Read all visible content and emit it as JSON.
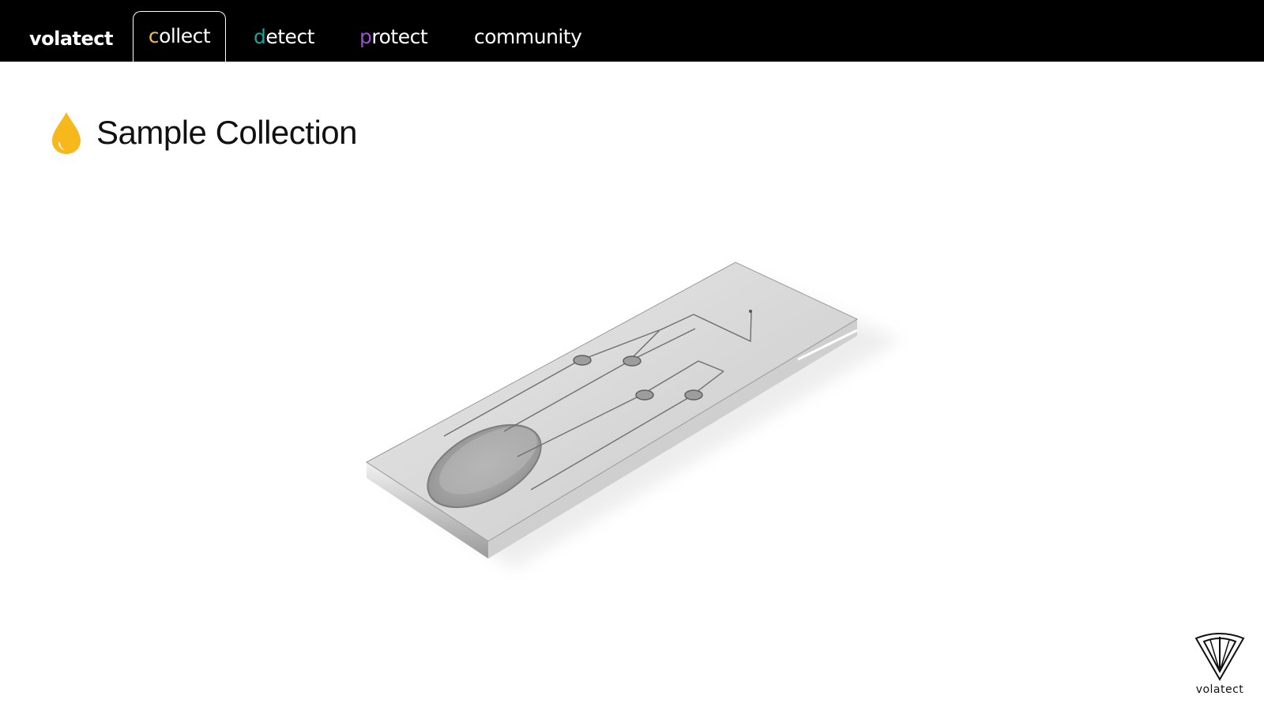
{
  "nav": {
    "brand": "volatect",
    "tabs": [
      {
        "first": "c",
        "rest": "ollect",
        "accent": "#f2c12e",
        "active": true
      },
      {
        "first": "d",
        "rest": "etect",
        "accent": "#1aa39a",
        "active": false
      },
      {
        "first": "p",
        "rest": "rotect",
        "accent": "#9b4fd8",
        "active": false
      },
      {
        "first": "",
        "rest": "community",
        "accent": "#ffffff",
        "active": false
      }
    ]
  },
  "page": {
    "title": "Sample Collection",
    "icon": "drop-icon",
    "icon_color": "#f6b81b"
  },
  "main": {
    "image": "microfluidic-chip-render"
  },
  "footer": {
    "logo_icon": "volatect-shield-icon",
    "logo_text": "volatect"
  },
  "colors": {
    "navbar_bg": "#000000",
    "page_bg": "#ffffff"
  }
}
